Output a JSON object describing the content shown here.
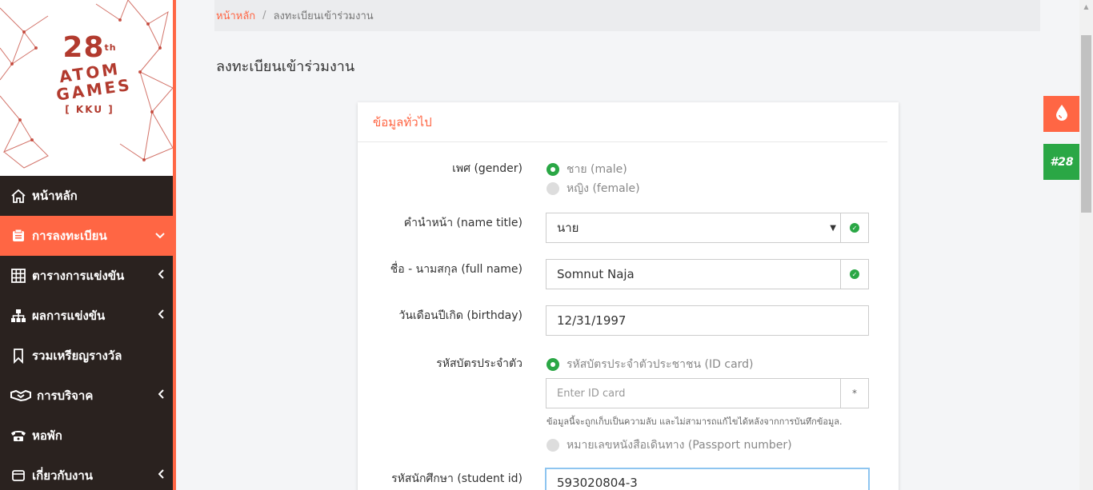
{
  "breadcrumb": {
    "home": "หน้าหลัก",
    "separator": "/",
    "current": "ลงทะเบียนเข้าร่วมงาน"
  },
  "page": {
    "title": "ลงทะเบียนเข้าร่วมงาน"
  },
  "logo": {
    "number": "28",
    "suffix": "th",
    "line1": "ATOM",
    "line2": "GAMES",
    "tag": "[ KKU ]"
  },
  "sidebar": {
    "items": [
      {
        "label": "หน้าหลัก",
        "icon": "home-icon"
      },
      {
        "label": "การลงทะเบียน",
        "icon": "register-icon",
        "active": true
      },
      {
        "label": "ตารางการแข่งขัน",
        "icon": "table-grid-icon"
      },
      {
        "label": "ผลการแข่งขัน",
        "icon": "sitemap-icon"
      },
      {
        "label": "รวมเหรียญรางวัล",
        "icon": "bookmark-icon"
      },
      {
        "label": "การบริจาค",
        "icon": "handshake-icon"
      },
      {
        "label": "หอพัก",
        "icon": "phone-icon"
      },
      {
        "label": "เกี่ยวกับงาน",
        "icon": "info-icon"
      }
    ]
  },
  "card": {
    "title": "ข้อมูลทั่วไป",
    "gender": {
      "label": "เพศ (gender)",
      "male": "ชาย (male)",
      "female": "หญิง (female)",
      "selected": "male"
    },
    "name_title": {
      "label": "คำนำหน้า (name title)",
      "value": "นาย"
    },
    "full_name": {
      "label": "ชื่อ - นามสกุล (full name)",
      "value": "Somnut Naja"
    },
    "birthday": {
      "label": "วันเดือนปีเกิด (birthday)",
      "value": "12/31/1997"
    },
    "id_card": {
      "label": "รหัสบัตรประจำตัว",
      "option_id": "รหัสบัตรประจำตัวประชาชน (ID card)",
      "placeholder": "Enter ID card",
      "required_mark": "*",
      "hint": "ข้อมูลนี้จะถูกเก็บเป็นความลับ และไม่สามารถแก้ไขได้หลังจากการบันทึกข้อมูล.",
      "option_passport": "หมายเลขหนังสือเดินทาง (Passport number)"
    },
    "student_id": {
      "label": "รหัสนักศึกษา (student id)",
      "value": "593020804-3"
    }
  },
  "floating": {
    "badge": "#28"
  },
  "colors": {
    "accent": "#ff6644",
    "sidebar": "#2a221f",
    "success": "#2aa745"
  }
}
